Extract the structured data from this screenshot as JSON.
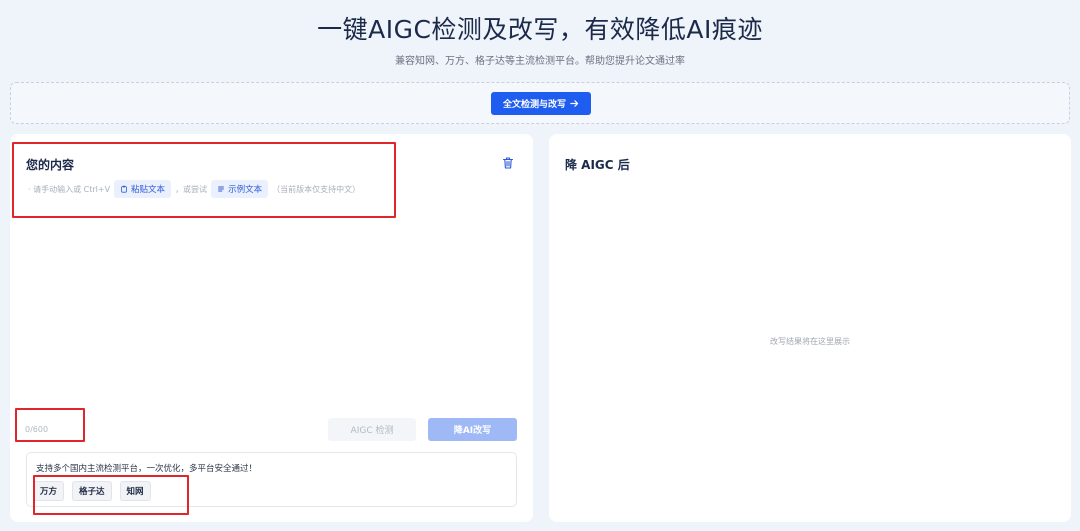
{
  "header": {
    "title": "一键AIGC检测及改写，有效降低AI痕迹",
    "subtitle": "兼容知网、万方、格子达等主流检测平台。帮助您提升论文通过率"
  },
  "action_bar": {
    "full_button_label": "全文检测与改写",
    "full_button_icon": "arrow-right-icon"
  },
  "input_panel": {
    "title": "您的内容",
    "hint_prefix": "· 请手动输入或 Ctrl+V",
    "paste_label": "粘贴文本",
    "hint_middle": "，或尝试",
    "example_label": "示例文本",
    "hint_suffix": "（当前版本仅支持中文）",
    "counter": "0/600",
    "detect_label": "AIGC 检测",
    "rewrite_label": "降AI改写",
    "support_text": "支持多个国内主流检测平台，一次优化，多平台安全通过！",
    "platforms": [
      "万方",
      "格子达",
      "知网"
    ]
  },
  "output_panel": {
    "title": "降 AIGC 后",
    "placeholder": "改写结果将在这里展示"
  },
  "colors": {
    "primary": "#1f5cf0",
    "primary_disabled": "#9fb8f6",
    "annotation_red": "#e0262b",
    "background": "#eff3fa"
  }
}
